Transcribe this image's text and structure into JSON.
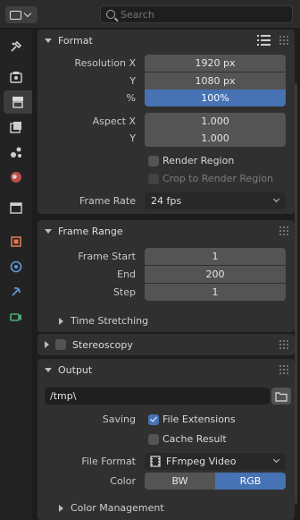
{
  "search": {
    "placeholder": "Search"
  },
  "sidebar": {
    "tabs": [
      {
        "icon": "tool-icon"
      },
      {
        "icon": "render-icon"
      },
      {
        "icon": "output-icon",
        "active": true
      },
      {
        "icon": "view-layer-icon"
      },
      {
        "icon": "scene-icon"
      },
      {
        "icon": "world-icon"
      },
      {
        "icon": "collection-icon"
      },
      {
        "icon": "object-icon"
      },
      {
        "icon": "physics-icon"
      },
      {
        "icon": "constraint-icon"
      },
      {
        "icon": "camera-data-icon"
      }
    ]
  },
  "format": {
    "title": "Format",
    "resolution_x_label": "Resolution X",
    "resolution_x": "1920 px",
    "resolution_y_label": "Y",
    "resolution_y": "1080 px",
    "percent_label": "%",
    "percent": "100%",
    "aspect_x_label": "Aspect X",
    "aspect_x": "1.000",
    "aspect_y_label": "Y",
    "aspect_y": "1.000",
    "render_region": "Render Region",
    "crop_region": "Crop to Render Region",
    "frame_rate_label": "Frame Rate",
    "frame_rate": "24 fps"
  },
  "frame_range": {
    "title": "Frame Range",
    "start_label": "Frame Start",
    "start": "1",
    "end_label": "End",
    "end": "200",
    "step_label": "Step",
    "step": "1",
    "time_stretching": "Time Stretching"
  },
  "stereoscopy": {
    "title": "Stereoscopy"
  },
  "output": {
    "title": "Output",
    "path": "/tmp\\",
    "saving_label": "Saving",
    "file_extensions": "File Extensions",
    "cache_result": "Cache Result",
    "file_format_label": "File Format",
    "file_format": "FFmpeg Video",
    "color_label": "Color",
    "color_bw": "BW",
    "color_rgb": "RGB",
    "color_management": "Color Management"
  },
  "colors": {
    "accent": "#4772b3",
    "panel": "#303030",
    "field": "#545454"
  }
}
